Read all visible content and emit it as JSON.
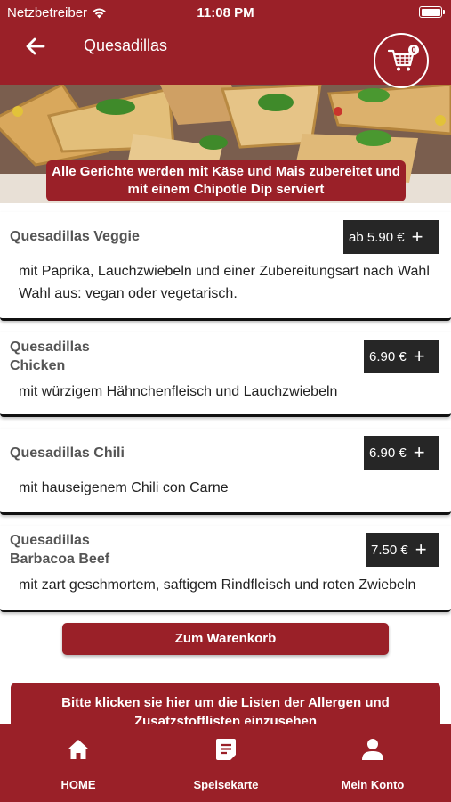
{
  "status_bar": {
    "carrier": "Netzbetreiber",
    "time": "11:08 PM"
  },
  "header": {
    "title": "Quesadillas",
    "cart_count": "0"
  },
  "notice": "Alle Gerichte werden mit Käse und Mais zubereitet und mit einem Chipotle Dip serviert",
  "items": [
    {
      "name": "Quesadillas Veggie",
      "price": "ab 5.90 €",
      "description": "mit Paprika, Lauchzwiebeln und einer Zubereitungsart nach Wahl Wahl aus: vegan oder vegetarisch."
    },
    {
      "name": "Quesadillas Chicken",
      "price": "6.90 €",
      "description": "mit würzigem Hähnchenfleisch und Lauchzwiebeln"
    },
    {
      "name": "Quesadillas Chili",
      "price": "6.90 €",
      "description": "mit hauseigenem Chili con Carne"
    },
    {
      "name": "Quesadillas Barbacoa Beef",
      "price": "7.50 €",
      "description": "mit zart geschmortem, saftigem Rindfleisch und roten Zwiebeln"
    }
  ],
  "cart_button": "Zum Warenkorb",
  "allergen_notice": "Bitte klicken sie hier um die Listen der Allergen und Zusatzstofflisten einzusehen",
  "nav": [
    {
      "label": "HOME",
      "icon": "home-icon"
    },
    {
      "label": "Speisekarte",
      "icon": "menu-card-icon"
    },
    {
      "label": "Mein Konto",
      "icon": "user-icon"
    }
  ],
  "colors": {
    "brand": "#9a2028",
    "price_bg": "#262626"
  }
}
